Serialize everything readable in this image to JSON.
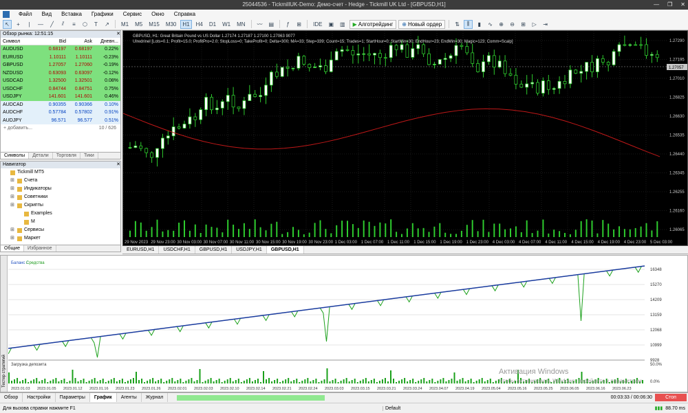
{
  "window": {
    "title": "25044536 - TickmillUK-Demo: Демо-счет - Hedge - Tickmill UK Ltd - [GBPUSD,H1]",
    "controls": [
      "—",
      "❐",
      "✕"
    ]
  },
  "menu": [
    "Файл",
    "Вид",
    "Вставка",
    "Графики",
    "Сервис",
    "Окно",
    "Справка"
  ],
  "toolbar": {
    "timeframes": [
      "M1",
      "M5",
      "M15",
      "M30",
      "H1",
      "H4",
      "D1",
      "W1",
      "MN"
    ],
    "active_timeframe": "H1",
    "ide_label": "IDE",
    "algo_label": "Алготрейдинг",
    "new_order_label": "Новый ордер"
  },
  "market_watch": {
    "title": "Обзор рынка: 12:51:15",
    "headers": [
      "Символ",
      "Bid",
      "Ask",
      "Дневн..."
    ],
    "rows": [
      {
        "sym": "AUDUSD",
        "bid": "0.68197",
        "ask": "0.68197",
        "chg": "0.22%",
        "state": "up"
      },
      {
        "sym": "EURUSD",
        "bid": "1.10111",
        "ask": "1.10111",
        "chg": "-0.23%",
        "state": "up"
      },
      {
        "sym": "GBPUSD",
        "bid": "1.27057",
        "ask": "1.27060",
        "chg": "-0.19%",
        "state": "up"
      },
      {
        "sym": "NZDUSD",
        "bid": "0.63093",
        "ask": "0.63097",
        "chg": "-0.12%",
        "state": "up"
      },
      {
        "sym": "USDCAD",
        "bid": "1.32500",
        "ask": "1.32501",
        "chg": "0.08%",
        "state": "up"
      },
      {
        "sym": "USDCHF",
        "bid": "0.84744",
        "ask": "0.84751",
        "chg": "0.75%",
        "state": "up"
      },
      {
        "sym": "USDJPY",
        "bid": "141.601",
        "ask": "141.601",
        "chg": "0.46%",
        "state": "up"
      },
      {
        "sym": "AUDCAD",
        "bid": "0.90355",
        "ask": "0.90366",
        "chg": "0.10%",
        "state": "dn"
      },
      {
        "sym": "AUDCHF",
        "bid": "0.57784",
        "ask": "0.57802",
        "chg": "0.91%",
        "state": "dn"
      },
      {
        "sym": "AUDJPY",
        "bid": "96.571",
        "ask": "96.577",
        "chg": "0.51%",
        "state": "dn"
      }
    ],
    "add_label": "+ добавить...",
    "count": "10 / 626",
    "tabs": [
      "Символы",
      "Детали",
      "Торговля",
      "Тики"
    ]
  },
  "navigator": {
    "title": "Навигатор",
    "items": [
      {
        "label": "Tickmill MT5",
        "lvl": 0
      },
      {
        "label": "Счета",
        "lvl": 1
      },
      {
        "label": "Индикаторы",
        "lvl": 1
      },
      {
        "label": "Советники",
        "lvl": 1
      },
      {
        "label": "Скрипты",
        "lvl": 1
      },
      {
        "label": "Examples",
        "lvl": 2
      },
      {
        "label": "M",
        "lvl": 2
      },
      {
        "label": "Сервисы",
        "lvl": 1
      },
      {
        "label": "Маркет",
        "lvl": 1
      }
    ],
    "tabs": [
      "Общие",
      "Избранное"
    ]
  },
  "chart": {
    "symbol_line": "GBPUSD, H1:  Great Britain Pound vs US Dollar  1.27174 1.27187 1.27100 1.27063  9077",
    "indicator_line": "Ulredrinel [Lots=0.1; Profit=15.0; ProfitPro=2.0; StopLoss=0; TakeProfit=0; Delta=300; MA=33; Step=339; Count=15; Trades=1; StartHour=0; StartMin=30; EndHour=23; EndMin=30; Magic=123; Comm=Scalp]",
    "price_labels": [
      "1.27290",
      "1.27195",
      "1.27010",
      "1.26825",
      "1.26630",
      "1.26535",
      "1.26440",
      "1.26345",
      "1.26255",
      "1.26160",
      "1.26065"
    ],
    "current_price": "1.27057",
    "time_labels": [
      "29 Nov 2023",
      "29 Nov 23:00",
      "30 Nov 03:00",
      "30 Nov 07:00",
      "30 Nov 11:00",
      "30 Nov 15:00",
      "30 Nov 19:00",
      "30 Nov 23:00",
      "1 Dec 03:00",
      "1 Dec 07:00",
      "1 Dec 11:00",
      "1 Dec 15:00",
      "1 Dec 19:00",
      "1 Dec 23:00",
      "4 Dec 03:00",
      "4 Dec 07:00",
      "4 Dec 11:00",
      "4 Dec 15:00",
      "4 Dec 19:00",
      "4 Dec 23:00",
      "5 Dec 03:00"
    ],
    "tabs": [
      "EURUSD,H1",
      "USDCHF,H1",
      "GBPUSD,H1",
      "USDJPY,H1",
      "GBPUSD,H1"
    ],
    "active_tab": 4
  },
  "tester": {
    "side_label": "Тестер стратегий",
    "balance_legend": "Баланс",
    "equity_legend": "Средства",
    "balance_labels": [
      "16348",
      "15270",
      "14209",
      "13159",
      "12068",
      "10999",
      "9928"
    ],
    "deposit_label": "Загрузка депозита",
    "deposit_pct": [
      "50.0%",
      "0.0%"
    ],
    "date_labels": [
      "2023.01.03",
      "2023.01.05",
      "2023.01.12",
      "2023.01.16",
      "2023.01.23",
      "2023.01.26",
      "2023.02.01",
      "2023.02.03",
      "2023.02.10",
      "2023.02.14",
      "2023.02.21",
      "2023.02.24",
      "2023.03.03",
      "2023.03.15",
      "2023.03.21",
      "2023.03.24",
      "2023.04.07",
      "2023.04.19",
      "2023.05.04",
      "2023.05.16",
      "2023.05.25",
      "2023.06.05",
      "2023.06.16",
      "2023.06.23"
    ],
    "tabs": [
      "Обзор",
      "Настройки",
      "Параметры",
      "График",
      "Агенты",
      "Журнал"
    ],
    "active_tab": 3,
    "progress": 0.58,
    "timer": "00:03:33 / 00:06:30",
    "stop_label": "Стоп"
  },
  "status": {
    "hint": "Для вызова справки нажмите F1",
    "profile": "Default",
    "ping": "88.70 ms"
  },
  "watermark": {
    "title": "Активация Windows",
    "sub": "Чтобы активировать Windows, перейдите к параметрам"
  }
}
